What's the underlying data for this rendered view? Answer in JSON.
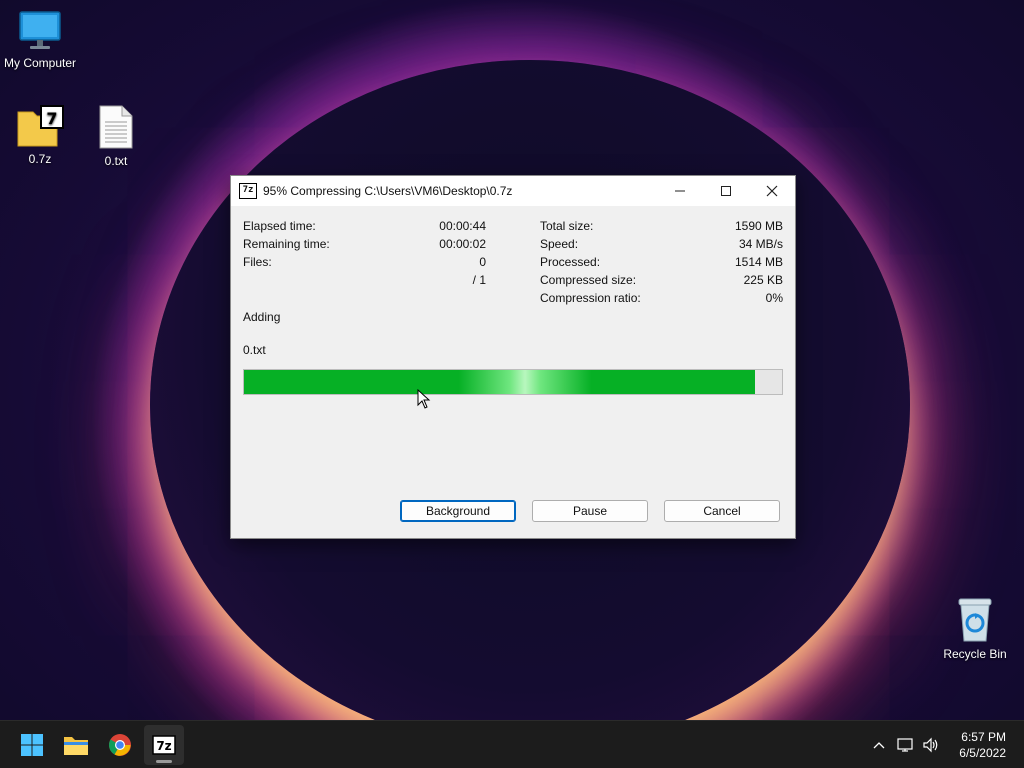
{
  "desktop": {
    "icons": [
      {
        "label": "My Computer"
      },
      {
        "label": "0.7z"
      },
      {
        "label": "0.txt"
      },
      {
        "label": "Recycle Bin"
      }
    ]
  },
  "dialog": {
    "title": "95% Compressing C:\\Users\\VM6\\Desktop\\0.7z",
    "app_icon_text": "7z",
    "left_stats": [
      {
        "label": "Elapsed time:",
        "value": "00:00:44"
      },
      {
        "label": "Remaining time:",
        "value": "00:00:02"
      },
      {
        "label": "Files:",
        "value": "0"
      },
      {
        "label": "",
        "value": "/ 1"
      }
    ],
    "right_stats": [
      {
        "label": "Total size:",
        "value": "1590 MB"
      },
      {
        "label": "Speed:",
        "value": "34 MB/s"
      },
      {
        "label": "Processed:",
        "value": "1514 MB"
      },
      {
        "label": "Compressed size:",
        "value": "225 KB"
      },
      {
        "label": "Compression ratio:",
        "value": "0%"
      }
    ],
    "action": "Adding",
    "current_file": "0.txt",
    "progress_fraction": 0.95,
    "buttons": {
      "background": "Background",
      "pause": "Pause",
      "cancel": "Cancel"
    }
  },
  "taskbar": {
    "apps": [
      "start-icon",
      "file-explorer-icon",
      "chrome-icon",
      "7zip-icon"
    ],
    "clock": {
      "time": "6:57 PM",
      "date": "6/5/2022"
    }
  },
  "colors": {
    "progress": "#06b025",
    "accent": "#0067c0",
    "taskbar": "#1c1c1c"
  }
}
